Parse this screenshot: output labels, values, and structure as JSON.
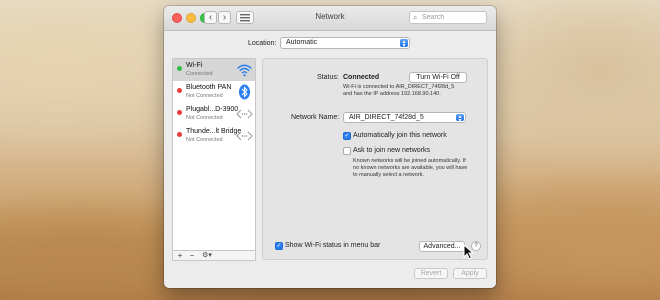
{
  "window": {
    "title": "Network",
    "search_placeholder": "Search"
  },
  "location": {
    "label": "Location:",
    "value": "Automatic"
  },
  "services": [
    {
      "name": "Wi-Fi",
      "status": "Connected",
      "status_color": "#2fbf43",
      "icon": "wifi-icon",
      "selected": true
    },
    {
      "name": "Bluetooth PAN",
      "status": "Not Connected",
      "status_color": "#e83b3b",
      "icon": "bluetooth-icon"
    },
    {
      "name": "Plugabl...D-3900",
      "status": "Not Connected",
      "status_color": "#e83b3b",
      "icon": "ethernet-arrows-icon"
    },
    {
      "name": "Thunde...lt Bridge",
      "status": "Not Connected",
      "status_color": "#e83b3b",
      "icon": "ethernet-arrows-icon"
    }
  ],
  "sidebar_footer": {
    "add": "+",
    "remove": "−",
    "actions": "⚙▾"
  },
  "detail": {
    "status_label": "Status:",
    "status_value": "Connected",
    "turn_off_button": "Turn Wi-Fi Off",
    "status_desc_1": "Wi-Fi is connected to AIR_DIRECT_74f28d_5",
    "status_desc_2": "and has the IP address 192.168.90.140.",
    "network_name_label": "Network Name:",
    "network_name_value": "AIR_DIRECT_74f28d_5",
    "auto_join_label": "Automatically join this network",
    "auto_join_checked": true,
    "ask_join_label": "Ask to join new networks",
    "ask_join_checked": false,
    "ask_desc_1": "Known networks will be joined automatically. If",
    "ask_desc_2": "no known networks are available, you will have",
    "ask_desc_3": "to manually select a network."
  },
  "bottom": {
    "show_status_label": "Show Wi-Fi status in menu bar",
    "show_status_checked": true,
    "advanced_button": "Advanced...",
    "help": "?",
    "revert_button": "Revert",
    "apply_button": "Apply"
  },
  "colors": {
    "accent": "#2a7ff0",
    "connected": "#2fbf43",
    "disconnected": "#e83b3b"
  }
}
